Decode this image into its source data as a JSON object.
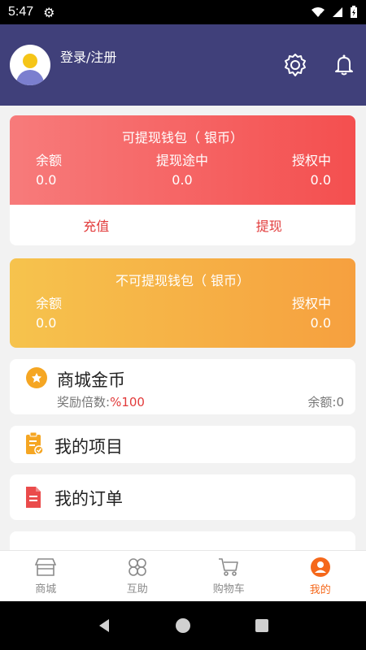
{
  "status": {
    "time": "5:47"
  },
  "header": {
    "login_text": "登录/注册"
  },
  "withdrawable_wallet": {
    "title": "可提现钱包（ 银币）",
    "balance_label": "余额",
    "balance_value": "0.0",
    "withdrawing_label": "提现途中",
    "withdrawing_value": "0.0",
    "authorized_label": "授权中",
    "authorized_value": "0.0",
    "recharge_label": "充值",
    "withdraw_label": "提现"
  },
  "non_withdrawable_wallet": {
    "title": "不可提现钱包（ 银币）",
    "balance_label": "余额",
    "balance_value": "0.0",
    "authorized_label": "授权中",
    "authorized_value": "0.0"
  },
  "mall_coins": {
    "title": "商城金币",
    "reward_label": "奖励倍数:",
    "reward_value": "%100",
    "balance_text": "余额:0"
  },
  "menu": {
    "my_projects": "我的项目",
    "my_orders": "我的订单"
  },
  "tabs": [
    {
      "label": "商城",
      "icon": "shop-icon"
    },
    {
      "label": "互助",
      "icon": "mutual-aid-icon"
    },
    {
      "label": "购物车",
      "icon": "cart-icon"
    },
    {
      "label": "我的",
      "icon": "profile-icon"
    }
  ],
  "colors": {
    "header": "#40407a",
    "red_card": "#f44f4f",
    "orange_card": "#f6a03f",
    "active_tab": "#f5681b",
    "accent_red": "#e23b3b"
  }
}
